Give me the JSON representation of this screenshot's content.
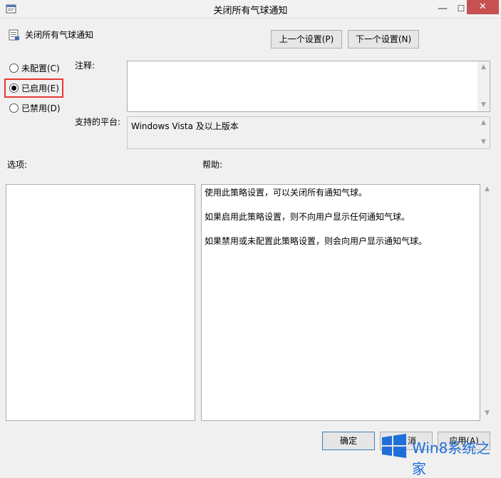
{
  "window": {
    "title": "关闭所有气球通知",
    "minimize_glyph": "—",
    "maximize_glyph": "☐",
    "close_glyph": "✕"
  },
  "header": {
    "policy_name": "关闭所有气球通知",
    "prev_button": "上一个设置(P)",
    "next_button": "下一个设置(N)"
  },
  "state": {
    "options": [
      {
        "label": "未配置(C)",
        "checked": false
      },
      {
        "label": "已启用(E)",
        "checked": true
      },
      {
        "label": "已禁用(D)",
        "checked": false
      }
    ]
  },
  "comment": {
    "label": "注释:",
    "value": ""
  },
  "platform": {
    "label": "支持的平台:",
    "value": "Windows Vista 及以上版本"
  },
  "options_pane": {
    "label": "选项:"
  },
  "help_pane": {
    "label": "帮助:",
    "paragraphs": [
      "使用此策略设置，可以关闭所有通知气球。",
      "如果启用此策略设置，则不向用户显示任何通知气球。",
      "如果禁用或未配置此策略设置，则会向用户显示通知气球。"
    ]
  },
  "footer": {
    "ok_button": "确定",
    "cancel_button": "消",
    "apply_button": "应用(A)"
  },
  "watermark": {
    "text": "Win8系统之家"
  },
  "colors": {
    "highlight": "#e53935",
    "close_button": "#c75050",
    "watermark": "#1e6fd9"
  }
}
